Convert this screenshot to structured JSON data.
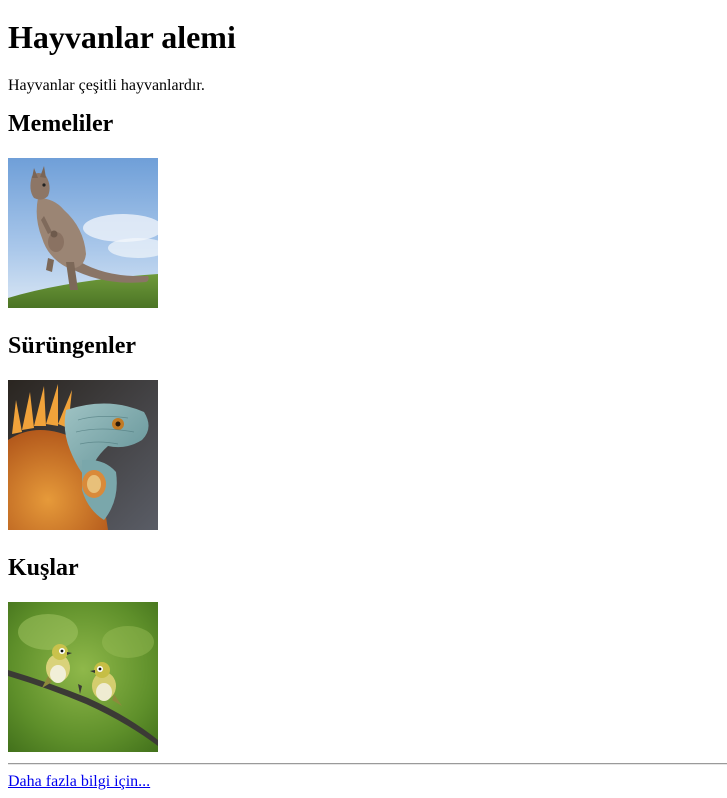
{
  "page": {
    "title": "Hayvanlar alemi",
    "intro": "Hayvanlar çeşitli hayvanlardır."
  },
  "sections": [
    {
      "heading": "Memeliler",
      "image": "kangaroo-photo"
    },
    {
      "heading": "Sürüngenler",
      "image": "iguana-photo"
    },
    {
      "heading": "Kuşlar",
      "image": "birds-on-branch-photo"
    }
  ],
  "footer": {
    "link_text": "Daha fazla bilgi için..."
  }
}
